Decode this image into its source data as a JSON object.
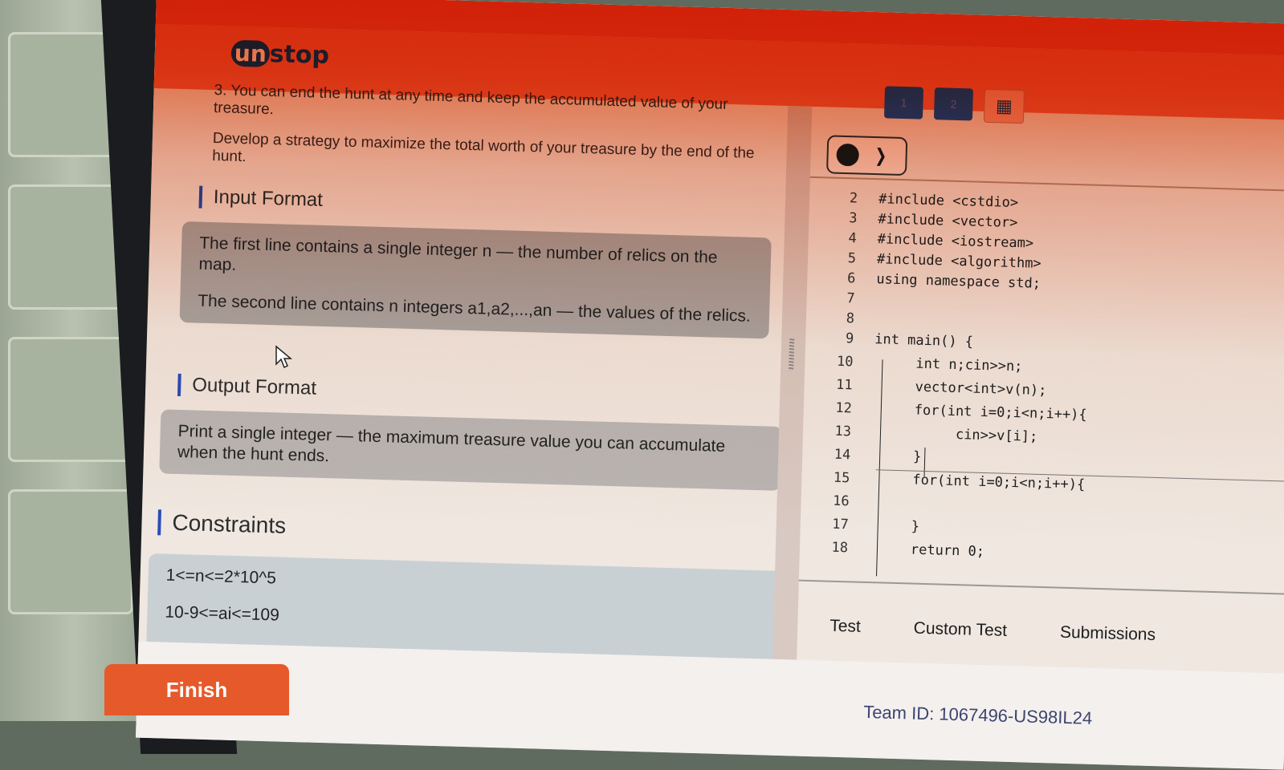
{
  "brand": {
    "logo_prefix": "un",
    "logo_suffix": "stop"
  },
  "question_nav": {
    "items": [
      "1",
      "2"
    ],
    "grid_icon": "grid-icon"
  },
  "problem": {
    "rule3": "3. You can end the hunt at any time and keep the accumulated value of your treasure.",
    "strategy": "Develop a strategy to maximize the total worth of your treasure by the end of the hunt.",
    "input_format": {
      "title": "Input Format",
      "line1": "The first line contains a single integer n — the number of relics on the map.",
      "line2": "The second line contains n integers a1,a2,...,an — the values of the relics."
    },
    "output_format": {
      "title": "Output Format",
      "text": "Print a single integer — the maximum treasure value you can accumulate when the hunt ends."
    },
    "constraints": {
      "title": "Constraints",
      "items": [
        "1<=n<=2*10^5",
        "10-9<=ai<=109"
      ]
    }
  },
  "editor": {
    "theme_toggle_icon": "moon-icon",
    "lines": [
      {
        "num": "2",
        "code": "#include <cstdio>"
      },
      {
        "num": "3",
        "code": "#include <vector>"
      },
      {
        "num": "4",
        "code": "#include <iostream>"
      },
      {
        "num": "5",
        "code": "#include <algorithm>"
      },
      {
        "num": "6",
        "code": "using namespace std;"
      },
      {
        "num": "7",
        "code": ""
      },
      {
        "num": "8",
        "code": ""
      },
      {
        "num": "9",
        "code": "int main() {"
      },
      {
        "num": "10",
        "code": "int n;cin>>n;"
      },
      {
        "num": "11",
        "code": "vector<int>v(n);"
      },
      {
        "num": "12",
        "code": "for(int i=0;i<n;i++){"
      },
      {
        "num": "13",
        "code": "cin>>v[i];"
      },
      {
        "num": "14",
        "code": "}"
      },
      {
        "num": "15",
        "code": "for(int i=0;i<n;i++){"
      },
      {
        "num": "16",
        "code": ""
      },
      {
        "num": "17",
        "code": "}"
      },
      {
        "num": "18",
        "code": "return 0;"
      }
    ],
    "tabs": [
      "Test",
      "Custom Test",
      "Submissions"
    ]
  },
  "footer": {
    "finish_label": "Finish",
    "team_id": "Team ID: 1067496-US98IL24"
  }
}
